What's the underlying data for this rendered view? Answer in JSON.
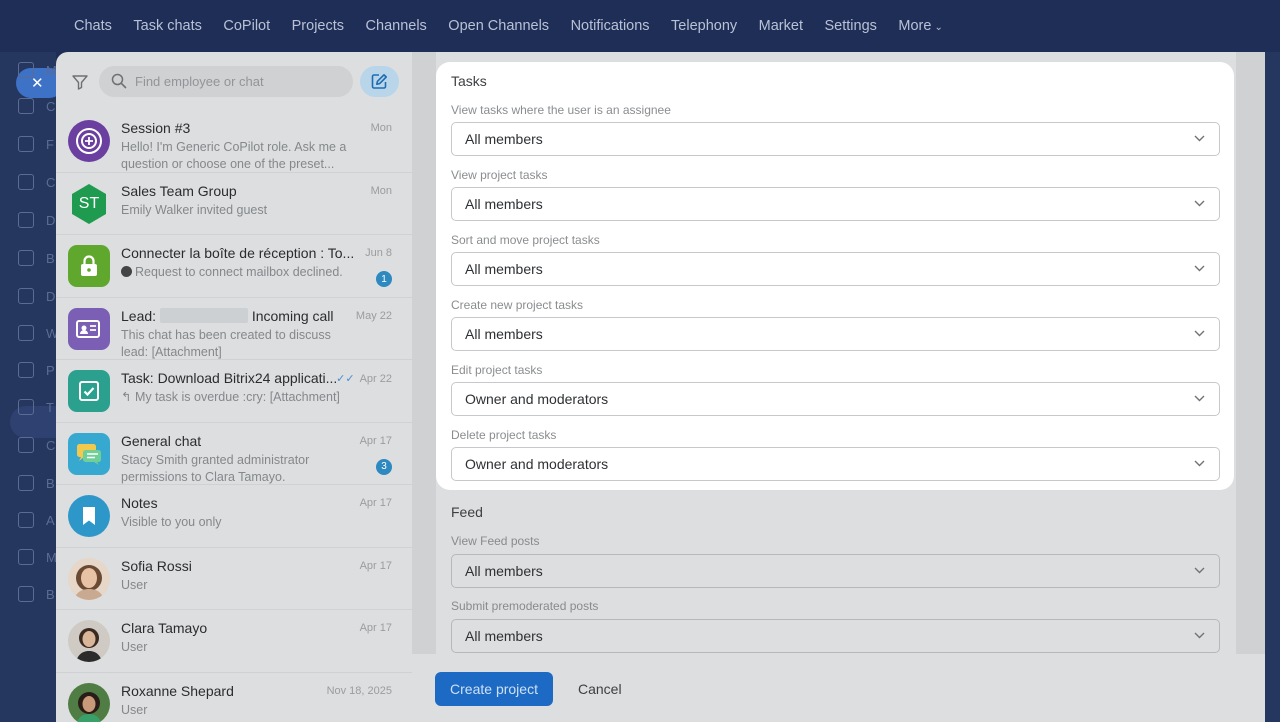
{
  "topnav": {
    "items": [
      "Chats",
      "Task chats",
      "CoPilot",
      "Projects",
      "Channels",
      "Open Channels",
      "Notifications",
      "Telephony",
      "Market",
      "Settings"
    ],
    "more_label": "More"
  },
  "rail": {
    "letters": [
      "M",
      "C",
      "F",
      "C",
      "D",
      "B",
      "D",
      "W",
      "P",
      "T",
      "C",
      "B",
      "A",
      "M",
      "B"
    ]
  },
  "search": {
    "placeholder": "Find employee or chat"
  },
  "chats": [
    {
      "title": "Session #3",
      "date": "Mon",
      "preview": "Hello! I'm Generic CoPilot role. Ask me a question or choose one of the preset...",
      "avatar": "copilot-icon",
      "color": "#6b3fa0"
    },
    {
      "title": "Sales Team Group",
      "date": "Mon",
      "preview": "Emily Walker invited guest",
      "avatar_text": "ST",
      "color": "#1e9b4f"
    },
    {
      "title": "Connecter la boîte de réception : To...",
      "date": "Jun 8",
      "preview": "Request to connect mailbox declined.",
      "badge": "1",
      "avatar": "lock-icon",
      "color": "#5fa82d"
    },
    {
      "title_prefix": "Lead:",
      "title_suffix": "Incoming call",
      "date": "May 22",
      "preview": "This chat has been created to discuss lead: [Attachment]",
      "avatar": "lead-card-icon",
      "color": "#7a5fb5"
    },
    {
      "title": "Task: Download Bitrix24 applicati...",
      "date": "Apr 22",
      "preview": "My task is overdue :cry: [Attachment]",
      "avatar": "task-check-icon",
      "color": "#2ba08f"
    },
    {
      "title": "General chat",
      "date": "Apr 17",
      "preview": "Stacy Smith granted administrator permissions to Clara Tamayo.",
      "badge": "3",
      "avatar": "chat-bubbles-icon",
      "color": "#37a8d0"
    },
    {
      "title": "Notes",
      "date": "Apr 17",
      "preview": "Visible to you only",
      "avatar": "bookmark-icon",
      "color": "#2e97c9"
    },
    {
      "title": "Sofia Rossi",
      "date": "Apr 17",
      "preview": "User",
      "avatar": "user-photo",
      "color": "#b98a6e"
    },
    {
      "title": "Clara Tamayo",
      "date": "Apr 17",
      "preview": "User",
      "avatar": "user-photo",
      "color": "#7b6a60"
    },
    {
      "title": "Roxanne Shepard",
      "date": "Nov 18, 2025",
      "preview": "User",
      "avatar": "user-photo",
      "color": "#3b6b3b"
    }
  ],
  "tasks": {
    "title": "Tasks",
    "fields": [
      {
        "label": "View tasks where the user is an assignee",
        "value": "All members"
      },
      {
        "label": "View project tasks",
        "value": "All members"
      },
      {
        "label": "Sort and move project tasks",
        "value": "All members"
      },
      {
        "label": "Create new project tasks",
        "value": "All members"
      },
      {
        "label": "Edit project tasks",
        "value": "Owner and moderators"
      },
      {
        "label": "Delete project tasks",
        "value": "Owner and moderators"
      }
    ]
  },
  "feed": {
    "title": "Feed",
    "fields": [
      {
        "label": "View Feed posts",
        "value": "All members"
      },
      {
        "label": "Submit premoderated posts",
        "value": "All members"
      }
    ]
  },
  "actions": {
    "create_label": "Create project",
    "cancel_label": "Cancel"
  }
}
